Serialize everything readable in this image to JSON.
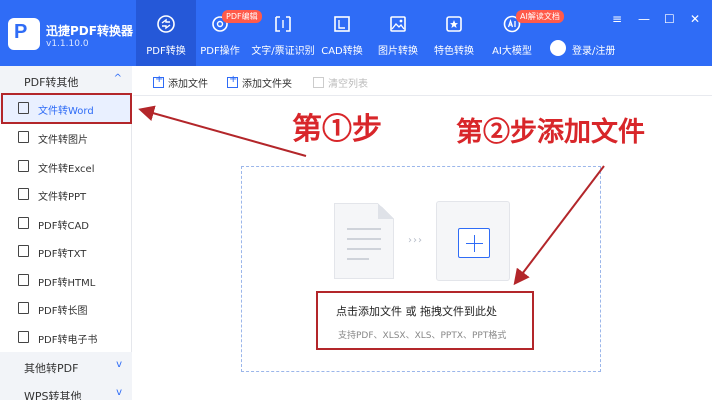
{
  "app": {
    "title": "迅捷PDF转换器",
    "version": "v1.1.10.0"
  },
  "nav": {
    "items": [
      {
        "label": "PDF转换",
        "icon": "convert-icon",
        "active": true
      },
      {
        "label": "PDF操作",
        "icon": "gear-icon",
        "badge": "PDF编辑"
      },
      {
        "label": "文字/票证识别",
        "icon": "scan-icon"
      },
      {
        "label": "CAD转换",
        "icon": "cad-icon"
      },
      {
        "label": "图片转换",
        "icon": "image-icon"
      },
      {
        "label": "特色转换",
        "icon": "star-icon"
      },
      {
        "label": "AI大模型",
        "icon": "ai-icon",
        "badge": "AI解读文档"
      }
    ],
    "user_label": "登录/注册"
  },
  "window_controls": [
    "≡",
    "—",
    "☐",
    "✕"
  ],
  "sidebar": {
    "groups": [
      {
        "title": "PDF转其他",
        "chevron": "^",
        "items": [
          "文件转Word",
          "文件转图片",
          "文件转Excel",
          "文件转PPT",
          "PDF转CAD",
          "PDF转TXT",
          "PDF转HTML",
          "PDF转长图",
          "PDF转电子书"
        ]
      },
      {
        "title": "其他转PDF",
        "chevron": "v"
      },
      {
        "title": "WPS转其他",
        "chevron": "v"
      }
    ]
  },
  "toolbar": {
    "add_file": "添加文件",
    "add_folder": "添加文件夹",
    "clear_list": "清空列表"
  },
  "dropzone": {
    "arrows": "›››",
    "main_hint": "点击添加文件 或 拖拽文件到此处",
    "sub_hint": "支持PDF、XLSX、XLS、PPTX、PPT格式"
  },
  "annotations": {
    "step1": "第①步",
    "step2": "第②步添加文件"
  },
  "colors": {
    "brand": "#2f6cf6",
    "annotation_red": "#d8262a",
    "badge_red": "#ff5a4a"
  }
}
